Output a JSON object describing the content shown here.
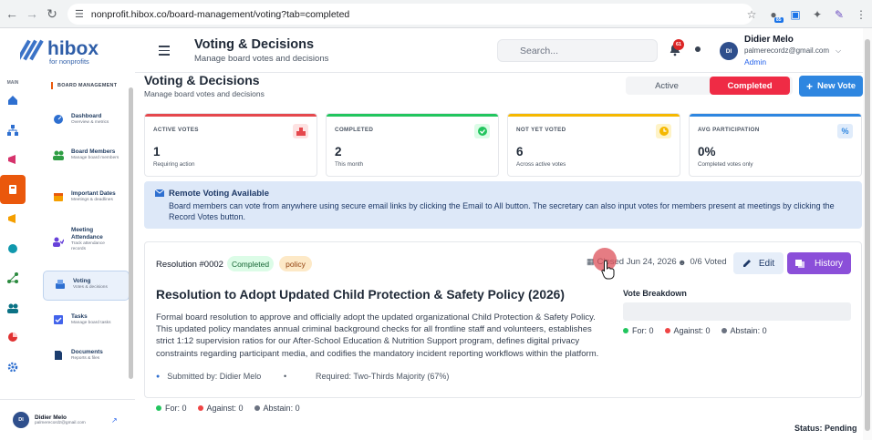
{
  "browser": {
    "url": "nonprofit.hibox.co/board-management/voting?tab=completed",
    "ext_badge": "85"
  },
  "brand": {
    "name": "hibox",
    "tagline": "for nonprofits"
  },
  "rail": {
    "label": "MAIN"
  },
  "sidebar": {
    "heading": "BOARD MANAGEMENT",
    "items": [
      {
        "title": "Dashboard",
        "desc": "Overview & metrics"
      },
      {
        "title": "Board Members",
        "desc": "Manage board members"
      },
      {
        "title": "Important Dates",
        "desc": "Meetings & deadlines"
      },
      {
        "title": "Meeting Attendance",
        "desc": "Track attendance records"
      },
      {
        "title": "Voting",
        "desc": "Votes & decisions"
      },
      {
        "title": "Tasks",
        "desc": "Manage board tasks"
      },
      {
        "title": "Documents",
        "desc": "Reports & files"
      }
    ],
    "user": {
      "initials": "DI",
      "name": "Didier Melo",
      "email": "palmerecordz@gmail.com"
    }
  },
  "header": {
    "title": "Voting & Decisions",
    "subtitle": "Manage board votes and decisions",
    "search_placeholder": "Search...",
    "notif_count": "61",
    "user": {
      "initials": "DI",
      "name": "Didier Melo",
      "email": "palmerecordz@gmail.com",
      "role": "Admin"
    }
  },
  "page": {
    "title": "Voting & Decisions",
    "subtitle": "Manage board votes and decisions",
    "tabs": [
      {
        "label": "Active"
      },
      {
        "label": "Completed"
      }
    ],
    "new_vote": "New Vote"
  },
  "stats": [
    {
      "label": "ACTIVE VOTES",
      "value": "1",
      "sub": "Requiring action",
      "color": "#e5484d",
      "icon_bg": "#fde2e2"
    },
    {
      "label": "COMPLETED",
      "value": "2",
      "sub": "This month",
      "color": "#22c55e",
      "icon_bg": "#dcfce7"
    },
    {
      "label": "NOT YET VOTED",
      "value": "6",
      "sub": "Across active votes",
      "color": "#f5b800",
      "icon_bg": "#fef3c7"
    },
    {
      "label": "AVG PARTICIPATION",
      "value": "0%",
      "sub": "Completed votes only",
      "color": "#2e86e0",
      "icon_bg": "#e0ecfb"
    }
  ],
  "info": {
    "title": "Remote Voting Available",
    "body": "Board members can vote from anywhere using secure email links by clicking the Email to All button. The secretary can also input votes for members present at meetings by clicking the Record Votes button."
  },
  "resolution": {
    "number": "Resolution #0002",
    "status": "Completed",
    "category": "policy",
    "closed": "Closed Jun 24, 2026",
    "voted": "0/6 Voted",
    "edit": "Edit",
    "history": "History",
    "title": "Resolution to Adopt Updated Child Protection & Safety Policy (2026)",
    "description": "Formal board resolution to approve and officially adopt the updated organizational Child Protection & Safety Policy. This updated policy mandates annual criminal background checks for all frontline staff and volunteers, establishes strict 1:12 supervision ratios for our After-School Education & Nutrition Support program, defines digital privacy constraints regarding participant media, and codifies the mandatory incident reporting workflows within the platform.",
    "submitted_by": "Submitted by: Didier Melo",
    "required": "Required: Two-Thirds Majority (67%)",
    "breakdown_title": "Vote Breakdown",
    "votes": {
      "for": "For: 0",
      "against": "Against: 0",
      "abstain": "Abstain: 0"
    },
    "vote_colors": {
      "for": "#22c55e",
      "against": "#ef4444",
      "abstain": "#6b7280"
    },
    "status_text": "Status: Pending"
  }
}
